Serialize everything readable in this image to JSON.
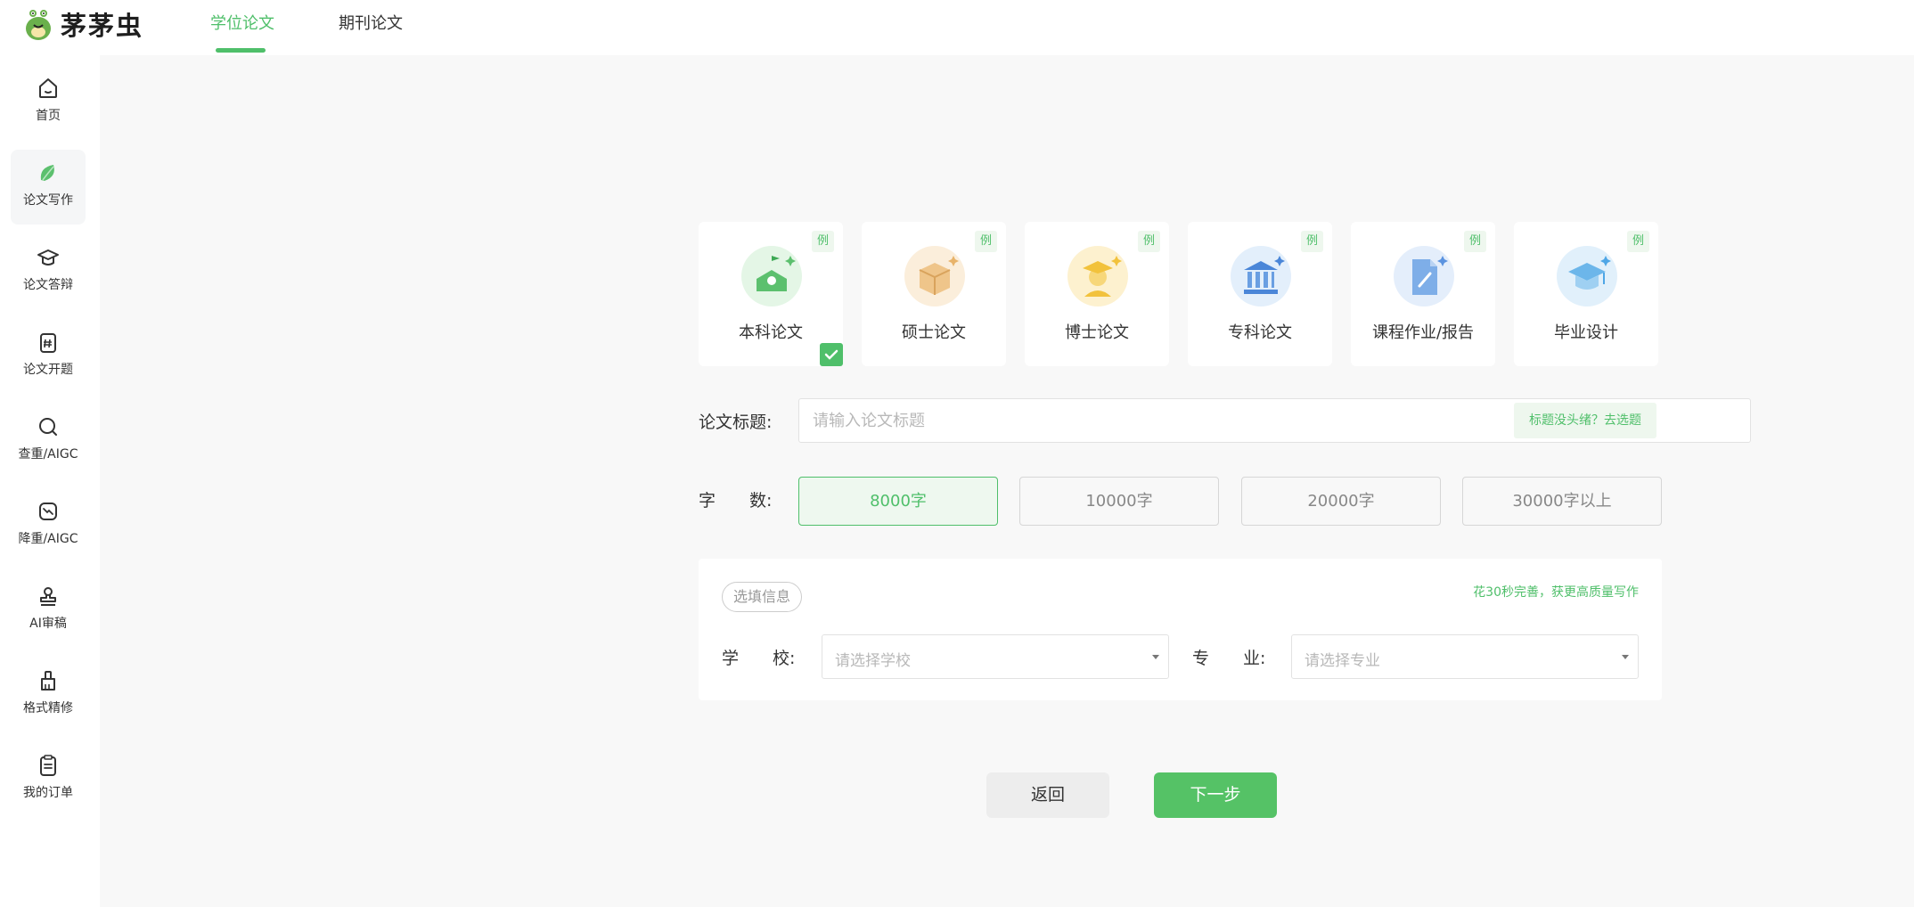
{
  "header": {
    "logo_text": "茅茅虫",
    "tabs": [
      {
        "label": "学位论文",
        "active": true
      },
      {
        "label": "期刊论文",
        "active": false
      }
    ]
  },
  "sidebar": {
    "items": [
      {
        "label": "首页",
        "icon": "home-icon"
      },
      {
        "label": "论文写作",
        "icon": "leaf-icon",
        "active": true
      },
      {
        "label": "论文答辩",
        "icon": "graduation-cap-icon"
      },
      {
        "label": "论文开题",
        "icon": "hash-clipboard-icon"
      },
      {
        "label": "查重/AIGC",
        "icon": "magnifier-icon"
      },
      {
        "label": "降重/AIGC",
        "icon": "trend-down-icon"
      },
      {
        "label": "AI审稿",
        "icon": "stamp-icon"
      },
      {
        "label": "格式精修",
        "icon": "brush-icon"
      },
      {
        "label": "我的订单",
        "icon": "order-clipboard-icon"
      }
    ]
  },
  "paper_types": {
    "example_badge": "例",
    "items": [
      {
        "label": "本科论文",
        "selected": true,
        "icon": "school-icon",
        "color": "#4fbf6a"
      },
      {
        "label": "硕士论文",
        "selected": false,
        "icon": "book-box-icon",
        "color": "#e8b36a"
      },
      {
        "label": "博士论文",
        "selected": false,
        "icon": "doctor-icon",
        "color": "#f2c23c"
      },
      {
        "label": "专科论文",
        "selected": false,
        "icon": "institution-icon",
        "color": "#4a86d8"
      },
      {
        "label": "课程作业/报告",
        "selected": false,
        "icon": "document-pen-icon",
        "color": "#5b93e0"
      },
      {
        "label": "毕业设计",
        "selected": false,
        "icon": "grad-cap-icon",
        "color": "#4ea6e6"
      }
    ]
  },
  "title_field": {
    "label": "论文标题:",
    "placeholder": "请输入论文标题",
    "value": "",
    "topic_link": "标题没头绪？去选题"
  },
  "word_count": {
    "label": "字　　数:",
    "options": [
      {
        "label": "8000字",
        "active": true
      },
      {
        "label": "10000字",
        "active": false
      },
      {
        "label": "20000字",
        "active": false
      },
      {
        "label": "30000字以上",
        "active": false
      }
    ]
  },
  "optional": {
    "tag": "选填信息",
    "hint": "花30秒完善，获更高质量写作",
    "school_label": "学　　校:",
    "school_placeholder": "请选择学校",
    "major_label": "专　　业:",
    "major_placeholder": "请选择专业"
  },
  "actions": {
    "back": "返回",
    "next": "下一步"
  },
  "colors": {
    "accent": "#4fbf6a",
    "accent_light": "#eef7ee",
    "background": "#f8f8f8"
  }
}
